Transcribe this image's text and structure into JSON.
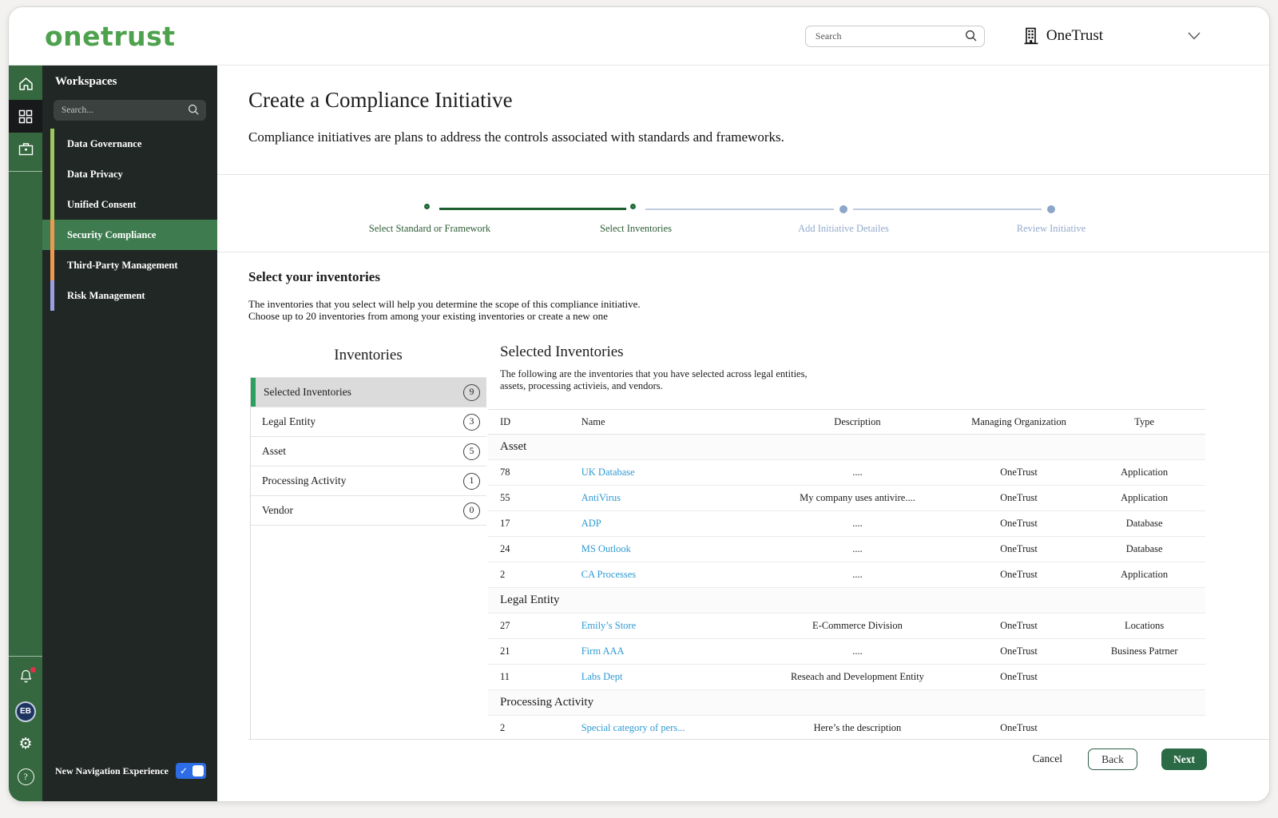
{
  "header": {
    "logo": "onetrust",
    "search_placeholder": "Search",
    "org_name": "OneTrust"
  },
  "rail": {
    "avatar_initials": "EB"
  },
  "sidebar": {
    "title": "Workspaces",
    "search_placeholder": "Search...",
    "items": [
      {
        "label": "Data Governance",
        "accent": "#9dc65c",
        "selected": false
      },
      {
        "label": "Data Privacy",
        "accent": "#9dc65c",
        "selected": false
      },
      {
        "label": "Unified Consent",
        "accent": "#9dc65c",
        "selected": false
      },
      {
        "label": "Security Compliance",
        "accent": "#ef9950",
        "selected": true
      },
      {
        "label": "Third-Party Management",
        "accent": "#ef9950",
        "selected": false
      },
      {
        "label": "Risk Management",
        "accent": "#999fe0",
        "selected": false
      }
    ],
    "toggle_label": "New Navigation Experience",
    "toggle_on": true
  },
  "page": {
    "title": "Create a Compliance Initiative",
    "subtitle": "Compliance initiatives are plans to address the controls associated with standards and frameworks."
  },
  "stepper": {
    "steps": [
      {
        "label": "Select Standard or Framework",
        "state": "done"
      },
      {
        "label": "Select Inventories",
        "state": "active"
      },
      {
        "label": "Add Initiative Detailes",
        "state": "todo"
      },
      {
        "label": "Review Initiative",
        "state": "todo"
      }
    ]
  },
  "section": {
    "title": "Select your inventories",
    "description_line1": "The inventories that you select will help you determine the scope of this compliance initiative.",
    "description_line2": "Choose up to 20 inventories from among your existing inventories or create a new one"
  },
  "inventories": {
    "title": "Inventories",
    "items": [
      {
        "label": "Selected Inventories",
        "count": "9",
        "selected": true
      },
      {
        "label": "Legal Entity",
        "count": "3",
        "selected": false
      },
      {
        "label": "Asset",
        "count": "5",
        "selected": false
      },
      {
        "label": "Processing Activity",
        "count": "1",
        "selected": false
      },
      {
        "label": "Vendor",
        "count": "0",
        "selected": false
      }
    ]
  },
  "selected_inventories": {
    "title": "Selected Inventories",
    "description_line1": "The following are the inventories that you have selected across legal entities,",
    "description_line2": "assets, processing activieis, and vendors.",
    "columns": [
      "ID",
      "Name",
      "Description",
      "Managing Organization",
      "Type"
    ],
    "groups": [
      {
        "name": "Asset",
        "rows": [
          {
            "id": "78",
            "name": "UK Database",
            "description": "....",
            "managing_org": "OneTrust",
            "type": "Application"
          },
          {
            "id": "55",
            "name": "AntiVirus",
            "description": "My company uses antivire....",
            "managing_org": "OneTrust",
            "type": "Application"
          },
          {
            "id": "17",
            "name": "ADP",
            "description": "....",
            "managing_org": "OneTrust",
            "type": "Database"
          },
          {
            "id": "24",
            "name": "MS Outlook",
            "description": "....",
            "managing_org": "OneTrust",
            "type": "Database"
          },
          {
            "id": "2",
            "name": "CA Processes",
            "description": "....",
            "managing_org": "OneTrust",
            "type": "Application"
          }
        ]
      },
      {
        "name": "Legal Entity",
        "rows": [
          {
            "id": "27",
            "name": "Emily’s Store",
            "description": "E-Commerce Division",
            "managing_org": "OneTrust",
            "type": "Locations"
          },
          {
            "id": "21",
            "name": "Firm AAA",
            "description": "....",
            "managing_org": "OneTrust",
            "type": "Business Patrner"
          },
          {
            "id": "11",
            "name": "Labs Dept",
            "description": "Reseach and Development Entity",
            "managing_org": "OneTrust",
            "type": ""
          }
        ]
      },
      {
        "name": "Processing Activity",
        "rows": [
          {
            "id": "2",
            "name": "Special category of pers...",
            "description": "Here’s the description",
            "managing_org": "OneTrust",
            "type": ""
          }
        ]
      }
    ]
  },
  "footer": {
    "cancel_label": "Cancel",
    "back_label": "Back",
    "next_label": "Next"
  },
  "colors": {
    "logo_green": "#4ea24e",
    "rail_green": "#35683f",
    "panel_dark": "#212724",
    "selected_workspace_green": "#3e7b4f",
    "accent_green_bar": "#9dc65c",
    "accent_orange_bar": "#ef9950",
    "accent_purple_bar": "#999fe0",
    "stepper_active_green": "#1e6b35",
    "stepper_inactive_blue": "#8ba6c9",
    "link_blue": "#2f9ad2",
    "next_button_green": "#2a6b45",
    "toggle_blue": "#2d6ce5",
    "notification_red": "#e0314b"
  }
}
